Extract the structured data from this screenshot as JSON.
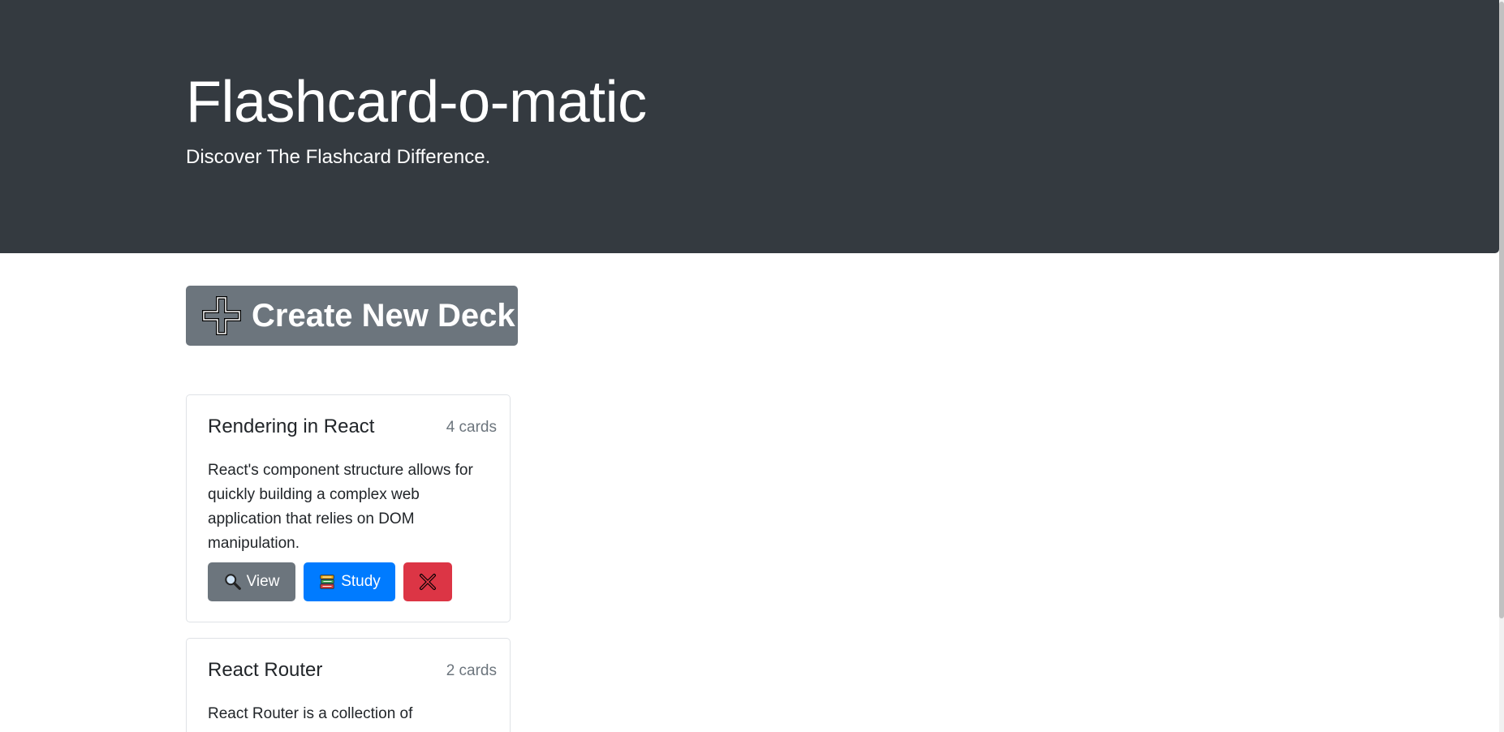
{
  "header": {
    "title": "Flashcard-o-matic",
    "subtitle": "Discover The Flashcard Difference."
  },
  "actions": {
    "create_deck_label": "Create New Deck",
    "create_deck_icon": "plus-icon"
  },
  "decks": [
    {
      "name": "Rendering in React",
      "count": "4 cards",
      "description": "React's component structure allows for quickly building a complex web application that relies on DOM manipulation.",
      "view_label": "View",
      "study_label": "Study"
    },
    {
      "name": "React Router",
      "count": "2 cards",
      "description": "React Router is a collection of"
    }
  ],
  "colors": {
    "header_bg": "#343a40",
    "secondary": "#6c757d",
    "primary": "#007bff",
    "danger": "#dc3545"
  }
}
